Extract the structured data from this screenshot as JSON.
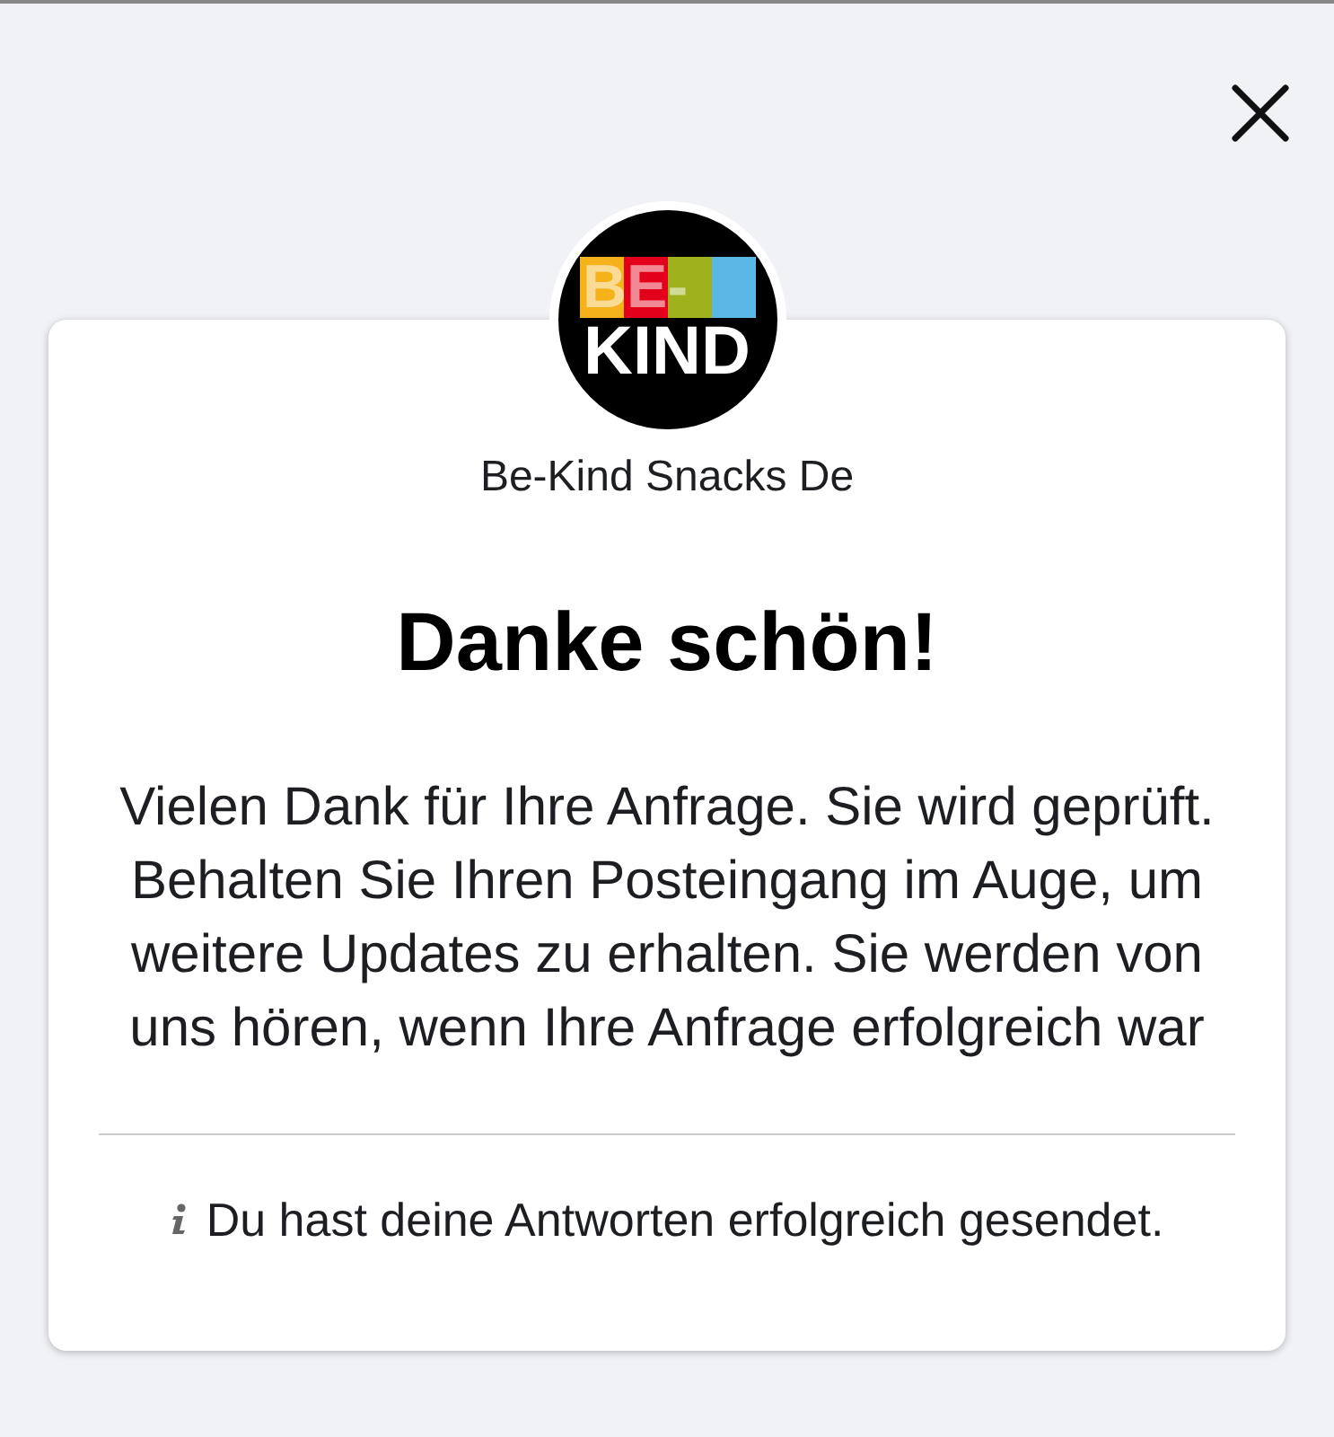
{
  "logo": {
    "line_1": "BE-",
    "line_2": "KIND"
  },
  "page_name": "Be-Kind Snacks De",
  "title": "Danke schön!",
  "message": "Vielen Dank für Ihre Anfrage. Sie wird geprüft. Behalten Sie Ihren Posteingang im Auge, um weitere Updates zu erhalten. Sie werden von uns hören, wenn Ihre Anfrage erfolgreich war",
  "footer_note": "Du hast deine Antworten erfolgreich gesendet."
}
